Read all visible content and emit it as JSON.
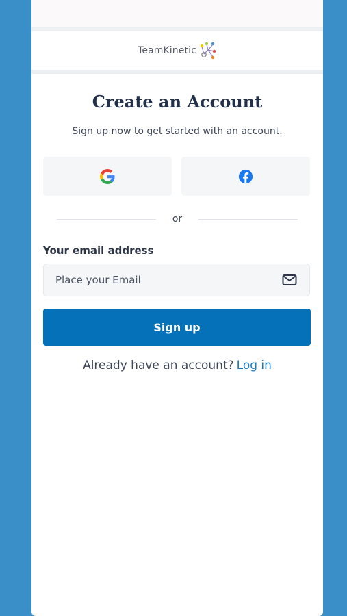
{
  "brand": {
    "name": "TeamKinetic"
  },
  "header": {
    "title": "Create an Account",
    "subtitle": "Sign up now to get started with an account."
  },
  "social": {
    "google_icon": "google-g-icon",
    "facebook_icon": "facebook-f-icon"
  },
  "separator": {
    "text": "or"
  },
  "email": {
    "label": "Your email address",
    "placeholder": "Place your Email",
    "value": "",
    "icon": "mail-icon"
  },
  "signup": {
    "label": "Sign up"
  },
  "login": {
    "prompt": "Already have an account?",
    "link_label": "Log in"
  },
  "colors": {
    "background": "#3b8fc9",
    "primary": "#0471b8",
    "link": "#1879c4",
    "title": "#22304a"
  }
}
